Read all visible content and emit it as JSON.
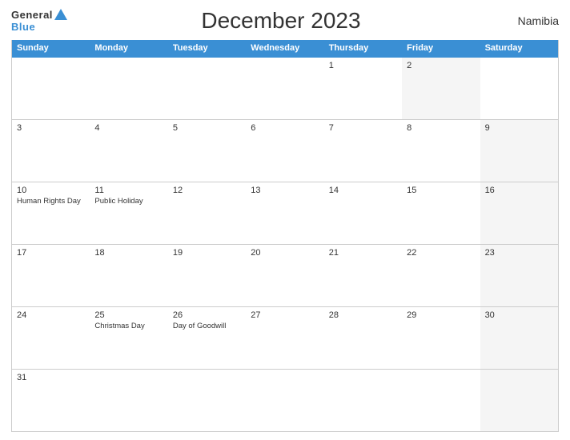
{
  "header": {
    "logo_general": "General",
    "logo_blue": "Blue",
    "title": "December 2023",
    "country": "Namibia"
  },
  "calendar": {
    "days_of_week": [
      "Sunday",
      "Monday",
      "Tuesday",
      "Wednesday",
      "Thursday",
      "Friday",
      "Saturday"
    ],
    "weeks": [
      [
        {
          "day": "",
          "event": "",
          "gray": false
        },
        {
          "day": "",
          "event": "",
          "gray": false
        },
        {
          "day": "",
          "event": "",
          "gray": false
        },
        {
          "day": "",
          "event": "",
          "gray": false
        },
        {
          "day": "1",
          "event": "",
          "gray": false
        },
        {
          "day": "2",
          "event": "",
          "gray": true
        },
        {
          "day": "",
          "event": "",
          "gray": false
        }
      ],
      [
        {
          "day": "3",
          "event": "",
          "gray": false
        },
        {
          "day": "4",
          "event": "",
          "gray": false
        },
        {
          "day": "5",
          "event": "",
          "gray": false
        },
        {
          "day": "6",
          "event": "",
          "gray": false
        },
        {
          "day": "7",
          "event": "",
          "gray": false
        },
        {
          "day": "8",
          "event": "",
          "gray": false
        },
        {
          "day": "9",
          "event": "",
          "gray": true
        }
      ],
      [
        {
          "day": "10",
          "event": "Human Rights Day",
          "gray": false
        },
        {
          "day": "11",
          "event": "Public Holiday",
          "gray": false
        },
        {
          "day": "12",
          "event": "",
          "gray": false
        },
        {
          "day": "13",
          "event": "",
          "gray": false
        },
        {
          "day": "14",
          "event": "",
          "gray": false
        },
        {
          "day": "15",
          "event": "",
          "gray": false
        },
        {
          "day": "16",
          "event": "",
          "gray": true
        }
      ],
      [
        {
          "day": "17",
          "event": "",
          "gray": false
        },
        {
          "day": "18",
          "event": "",
          "gray": false
        },
        {
          "day": "19",
          "event": "",
          "gray": false
        },
        {
          "day": "20",
          "event": "",
          "gray": false
        },
        {
          "day": "21",
          "event": "",
          "gray": false
        },
        {
          "day": "22",
          "event": "",
          "gray": false
        },
        {
          "day": "23",
          "event": "",
          "gray": true
        }
      ],
      [
        {
          "day": "24",
          "event": "",
          "gray": false
        },
        {
          "day": "25",
          "event": "Christmas Day",
          "gray": false
        },
        {
          "day": "26",
          "event": "Day of Goodwill",
          "gray": false
        },
        {
          "day": "27",
          "event": "",
          "gray": false
        },
        {
          "day": "28",
          "event": "",
          "gray": false
        },
        {
          "day": "29",
          "event": "",
          "gray": false
        },
        {
          "day": "30",
          "event": "",
          "gray": true
        }
      ],
      [
        {
          "day": "31",
          "event": "",
          "gray": false
        },
        {
          "day": "",
          "event": "",
          "gray": false
        },
        {
          "day": "",
          "event": "",
          "gray": false
        },
        {
          "day": "",
          "event": "",
          "gray": false
        },
        {
          "day": "",
          "event": "",
          "gray": false
        },
        {
          "day": "",
          "event": "",
          "gray": false
        },
        {
          "day": "",
          "event": "",
          "gray": true
        }
      ]
    ]
  }
}
